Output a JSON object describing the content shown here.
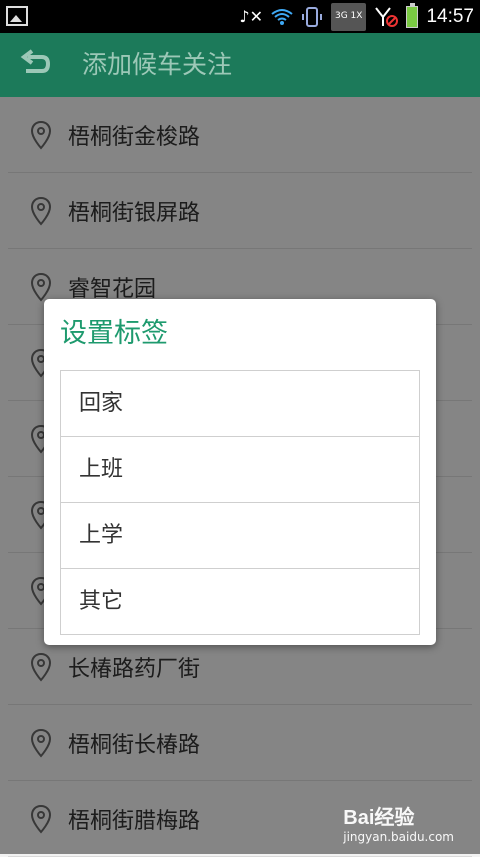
{
  "status_bar": {
    "network": "3G 1X",
    "time": "14:57"
  },
  "app_bar": {
    "title": "添加候车关注"
  },
  "list": [
    "梧桐街金梭路",
    "梧桐街银屏路",
    "睿智花园",
    "",
    "",
    "",
    "",
    "长椿路药厂街",
    "梧桐街长椿路",
    "梧桐街腊梅路"
  ],
  "dialog": {
    "title": "设置标签",
    "options": [
      "回家",
      "上班",
      "上学",
      "其它"
    ]
  },
  "watermark": {
    "brand": "Bai经验",
    "url": "jingyan.baidu.com"
  },
  "colors": {
    "app_bar": "#1c7a5a",
    "dialog_title": "#1e9a6e"
  }
}
